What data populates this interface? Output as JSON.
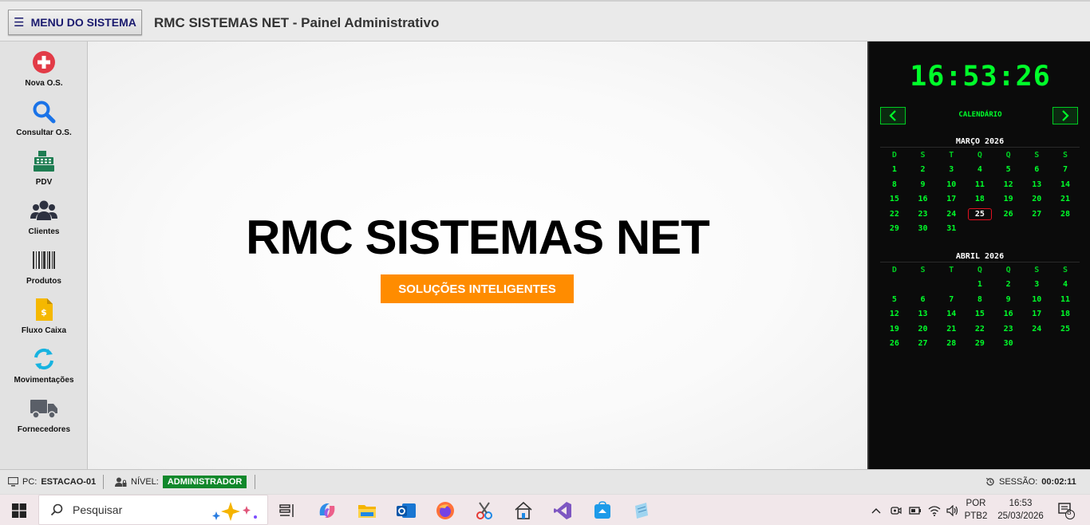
{
  "header": {
    "menu_label": "MENU DO SISTEMA",
    "title": "RMC SISTEMAS NET - Painel Administrativo"
  },
  "sidebar": {
    "items": [
      {
        "label": "Nova O.S.",
        "icon": "plus-circle-icon"
      },
      {
        "label": "Consultar O.S.",
        "icon": "search-icon"
      },
      {
        "label": "PDV",
        "icon": "cash-register-icon"
      },
      {
        "label": "Clientes",
        "icon": "users-icon"
      },
      {
        "label": "Produtos",
        "icon": "barcode-icon"
      },
      {
        "label": "Fluxo Caixa",
        "icon": "money-file-icon"
      },
      {
        "label": "Movimentações",
        "icon": "sync-icon"
      },
      {
        "label": "Fornecedores",
        "icon": "truck-icon"
      }
    ]
  },
  "main": {
    "brand": "RMC SISTEMAS NET",
    "tagline": "SOLUÇÕES INTELIGENTES"
  },
  "panel": {
    "clock": "16:53:26",
    "calendar_label": "CALENDÁRIO",
    "weekday_headers": [
      "D",
      "S",
      "T",
      "Q",
      "Q",
      "S",
      "S"
    ],
    "months": [
      {
        "title": "MARÇO 2026",
        "weeks": [
          [
            "1",
            "2",
            "3",
            "4",
            "5",
            "6",
            "7"
          ],
          [
            "8",
            "9",
            "10",
            "11",
            "12",
            "13",
            "14"
          ],
          [
            "15",
            "16",
            "17",
            "18",
            "19",
            "20",
            "21"
          ],
          [
            "22",
            "23",
            "24",
            "25",
            "26",
            "27",
            "28"
          ],
          [
            "29",
            "30",
            "31",
            "",
            "",
            "",
            ""
          ]
        ],
        "today": "25"
      },
      {
        "title": "ABRIL 2026",
        "weeks": [
          [
            "",
            "",
            "",
            "1",
            "2",
            "3",
            "4"
          ],
          [
            "5",
            "6",
            "7",
            "8",
            "9",
            "10",
            "11"
          ],
          [
            "12",
            "13",
            "14",
            "15",
            "16",
            "17",
            "18"
          ],
          [
            "19",
            "20",
            "21",
            "22",
            "23",
            "24",
            "25"
          ],
          [
            "26",
            "27",
            "28",
            "29",
            "30",
            "",
            ""
          ]
        ],
        "today": ""
      }
    ]
  },
  "status": {
    "pc_label": "PC:",
    "pc_value": "ESTACAO-01",
    "nivel_label": "NÍVEL:",
    "nivel_value": "ADMINISTRADOR",
    "sessao_label": "SESSÃO:",
    "sessao_value": "00:02:11"
  },
  "taskbar": {
    "search_placeholder": "Pesquisar",
    "lang_line1": "POR",
    "lang_line2": "PTB2",
    "time": "16:53",
    "date": "25/03/2026",
    "notification_count": "8"
  },
  "colors": {
    "accent_orange": "#ff8c00",
    "clock_green": "#00ff2a",
    "badge_green": "#11882b",
    "today_ring": "#e01020"
  }
}
